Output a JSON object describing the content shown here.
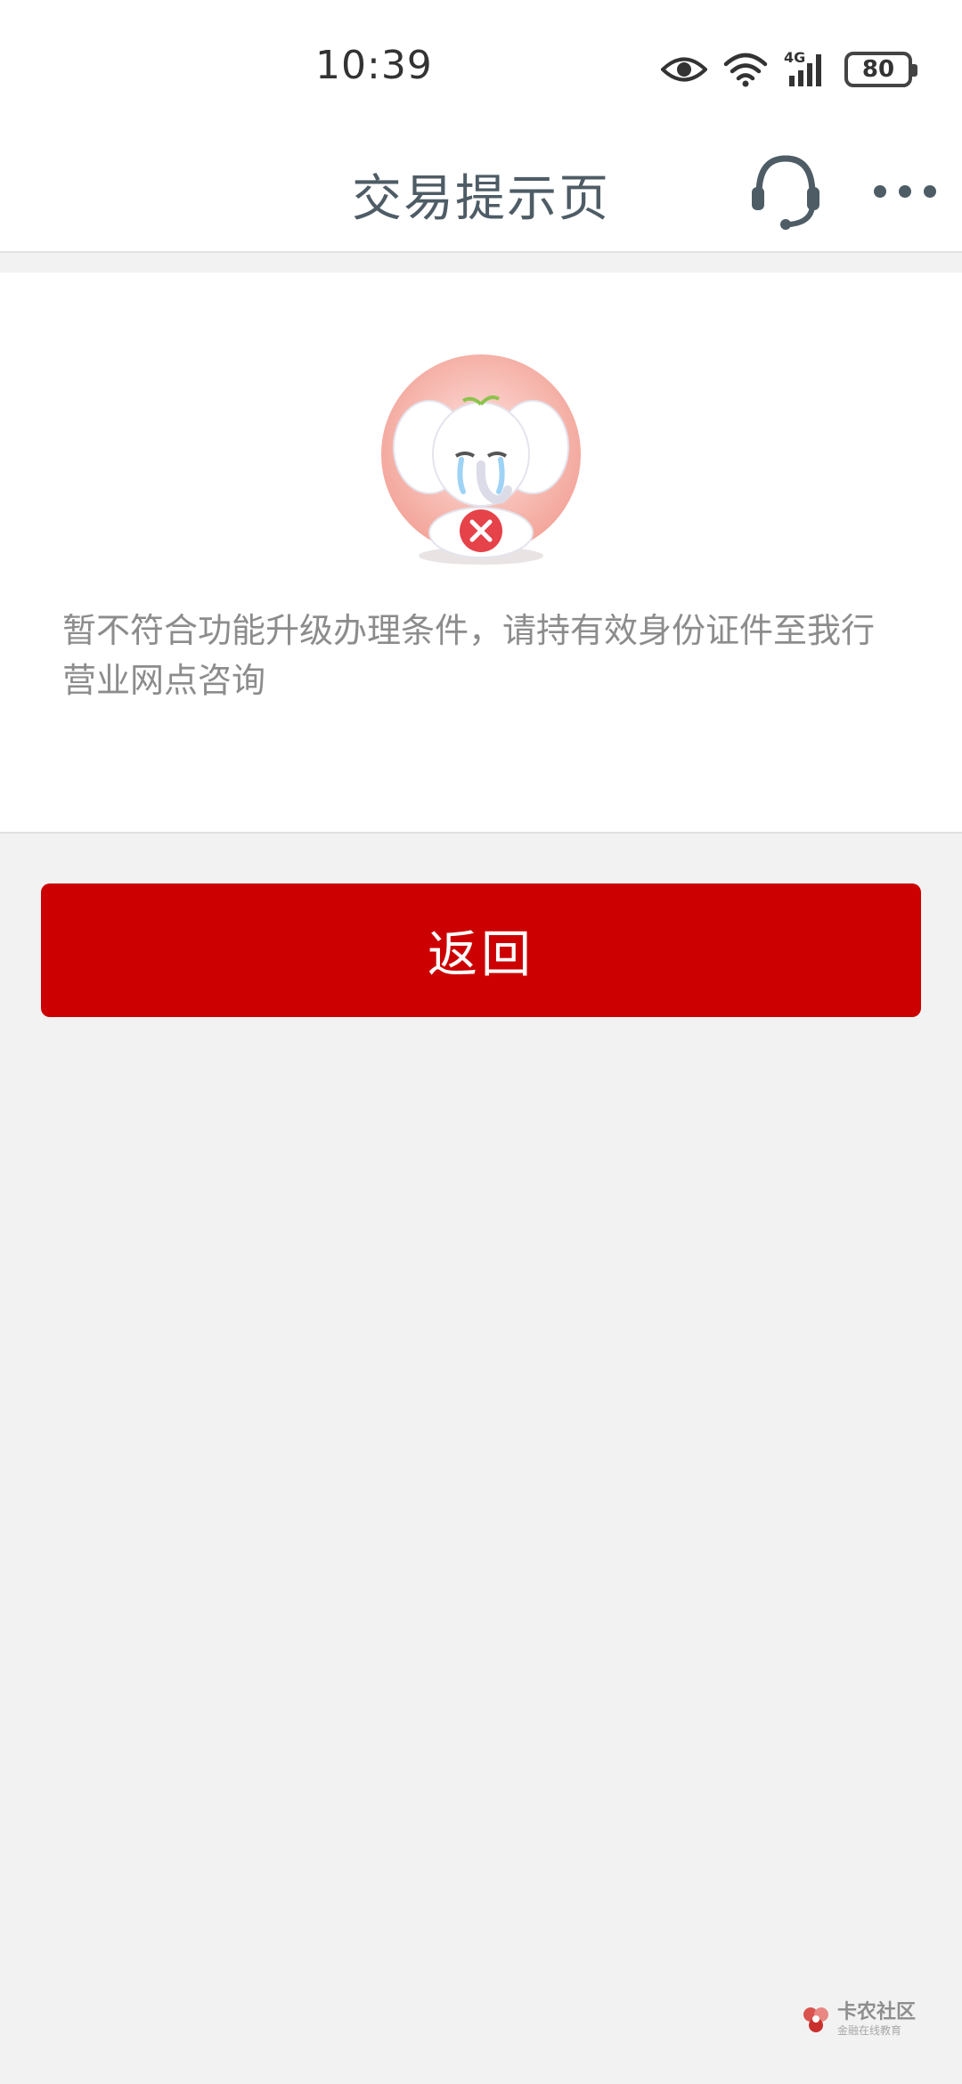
{
  "status_bar": {
    "time": "10:39",
    "network": "4G",
    "battery": "80",
    "icons": [
      "eye-icon",
      "wifi-icon",
      "signal-icon",
      "battery-icon"
    ]
  },
  "nav": {
    "title": "交易提示页",
    "right_icons": [
      "headset-icon",
      "more-icon"
    ]
  },
  "content": {
    "mascot": "crying-elephant-with-x-icon",
    "message": "暂不符合功能升级办理条件，请持有效身份证件至我行营业网点咨询"
  },
  "actions": {
    "back_label": "返回"
  },
  "watermark": {
    "main": "卡农社区",
    "sub": "金融在线教育"
  },
  "colors": {
    "primary_red": "#cc0000",
    "title_gray": "#4e5c66",
    "message_gray": "#8c8c8c",
    "background": "#f2f2f2"
  }
}
